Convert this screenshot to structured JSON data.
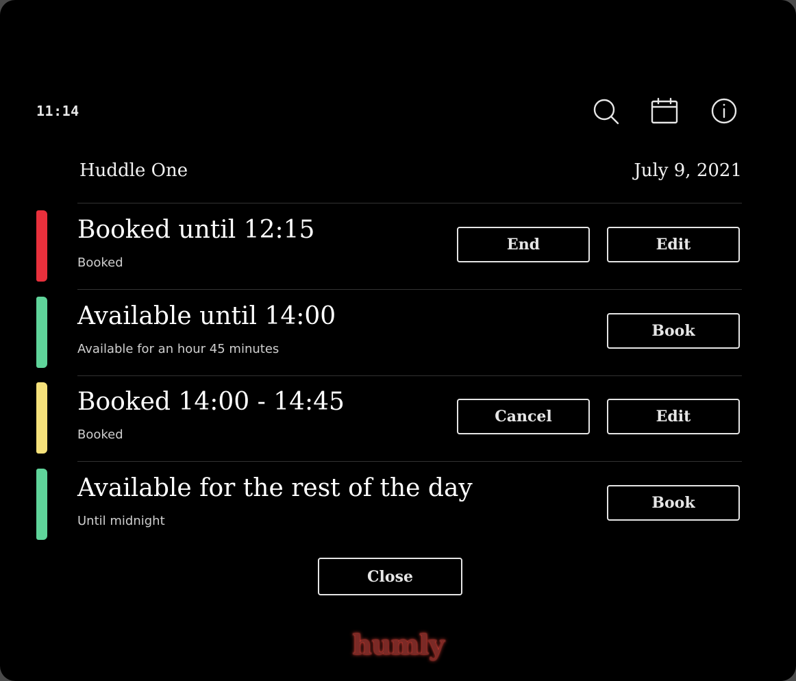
{
  "header": {
    "clock": "11:14",
    "room_name": "Huddle One",
    "date": "July 9, 2021",
    "icons": [
      "search-icon",
      "calendar-icon",
      "info-icon"
    ]
  },
  "slots": [
    {
      "title": "Booked until 12:15",
      "subtitle": "Booked",
      "status_color": "#e8303c",
      "buttons": [
        "End",
        "Edit"
      ]
    },
    {
      "title": "Available until 14:00",
      "subtitle": "Available for an hour 45 minutes",
      "status_color": "#5fd49a",
      "buttons": [
        "Book"
      ]
    },
    {
      "title": "Booked 14:00 - 14:45",
      "subtitle": "Booked",
      "status_color": "#f5e17a",
      "buttons": [
        "Cancel",
        "Edit"
      ]
    },
    {
      "title": "Available for the rest of the day",
      "subtitle": "Until midnight",
      "status_color": "#5fd49a",
      "buttons": [
        "Book"
      ]
    }
  ],
  "close_label": "Close",
  "logo": {
    "text": "humly",
    "color": "#7a2a26",
    "glow_color": "#e0443a"
  }
}
